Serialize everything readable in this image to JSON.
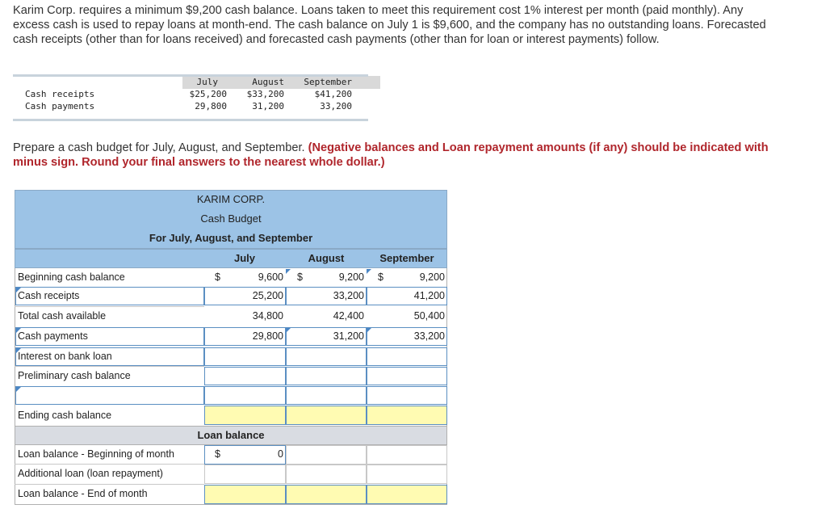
{
  "problem": {
    "intro": "Karim Corp. requires a minimum $9,200 cash balance. Loans taken to meet this requirement cost 1% interest per month (paid monthly). Any excess cash is used to repay loans at month-end. The cash balance on July 1 is $9,600, and the company has no outstanding loans. Forecasted cash receipts (other than for loans received) and forecasted cash payments (other than for loan or interest payments) follow.",
    "instruction": "Prepare a cash budget for July, August, and September.",
    "instruction_note": "(Negative balances and Loan repayment amounts (if any) should be indicated with minus sign. Round your final answers to the nearest whole dollar.)"
  },
  "given_table": {
    "headers": [
      "July",
      "August",
      "September"
    ],
    "rows": [
      {
        "label": "Cash receipts",
        "values": [
          "$25,200",
          "$33,200",
          "$41,200"
        ]
      },
      {
        "label": "Cash payments",
        "values": [
          "29,800",
          "31,200",
          "33,200"
        ]
      }
    ]
  },
  "budget": {
    "company": "KARIM CORP.",
    "title": "Cash Budget",
    "period": "For July, August, and September",
    "months": [
      "July",
      "August",
      "September"
    ],
    "dollar_sign": "$",
    "rows": [
      {
        "label": "Beginning cash balance",
        "values": [
          "9,600",
          "9,200",
          "9,200"
        ]
      },
      {
        "label": "Cash receipts",
        "values": [
          "25,200",
          "33,200",
          "41,200"
        ]
      },
      {
        "label": "Total cash available",
        "values": [
          "34,800",
          "42,400",
          "50,400"
        ]
      },
      {
        "label": "Cash payments",
        "values": [
          "29,800",
          "31,200",
          "33,200"
        ]
      },
      {
        "label": "Interest on bank loan",
        "values": [
          "",
          "",
          ""
        ]
      },
      {
        "label": "Preliminary cash balance",
        "values": [
          "",
          "",
          ""
        ]
      },
      {
        "label": "",
        "values": [
          "",
          "",
          ""
        ]
      },
      {
        "label": "Ending cash balance",
        "values": [
          "",
          "",
          ""
        ]
      }
    ],
    "loan_section_title": "Loan balance",
    "loan_rows": [
      {
        "label": "Loan balance - Beginning of month",
        "values": [
          "0",
          "",
          ""
        ]
      },
      {
        "label": "Additional loan (loan repayment)",
        "values": [
          "",
          "",
          ""
        ]
      },
      {
        "label": "Loan balance - End of month",
        "values": [
          "",
          "",
          ""
        ]
      }
    ]
  },
  "colors": {
    "header_blue": "#9cc3e6",
    "section_grey": "#d9dce2",
    "input_border": "#5b8fc2",
    "highlight_yellow": "#fffbb2",
    "instruction_red": "#b0262c"
  }
}
